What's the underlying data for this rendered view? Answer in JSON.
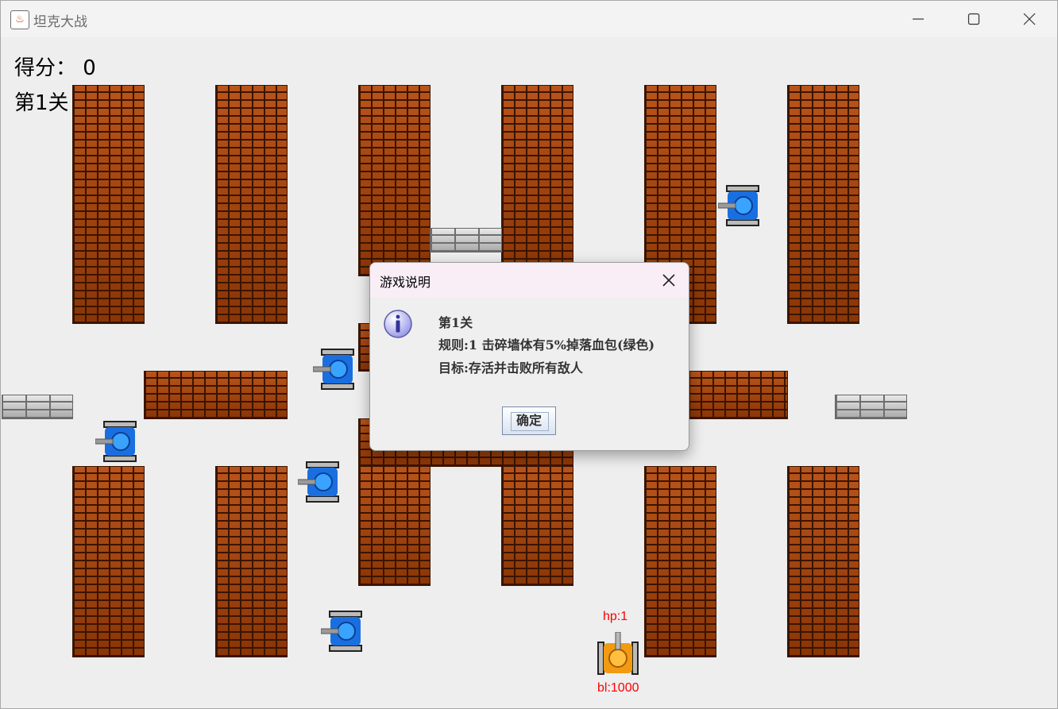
{
  "window": {
    "title": "坦克大战",
    "icon": "java-cup-icon"
  },
  "hud": {
    "score_label": "得分： 0",
    "level_label": "第1关"
  },
  "player": {
    "hp_label": "hp:1",
    "bl_label": "bl:1000",
    "color": "#f29b12"
  },
  "enemy_color": "#1a6fe0",
  "dialog": {
    "title": "游戏说明",
    "icon": "info-icon",
    "line1": "第1关",
    "line2": "规则:1 击碎墙体有5%掉落血包(绿色)",
    "line3": "目标:存活并击败所有敌人",
    "ok_label": "确定"
  }
}
